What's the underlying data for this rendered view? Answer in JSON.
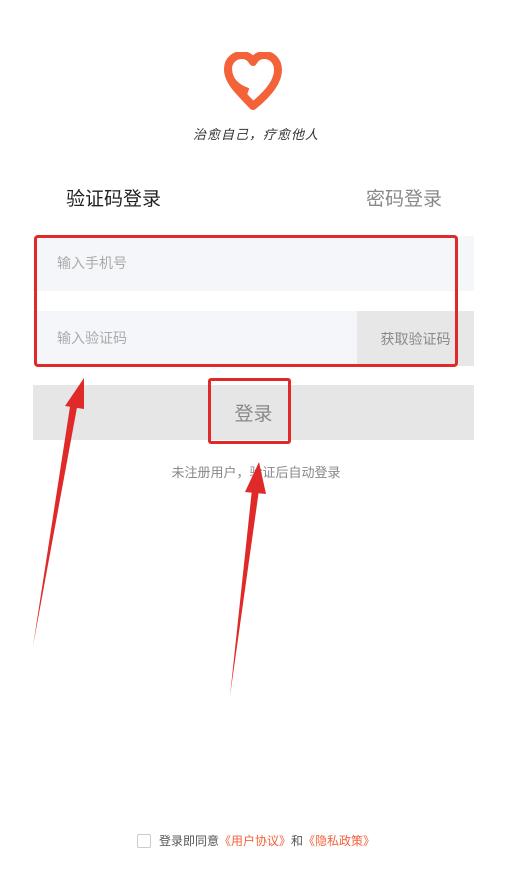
{
  "brand": {
    "logo_icon": "heart-logo-icon",
    "accent_color": "#f4623a",
    "slogan": "治愈自己，疗愈他人"
  },
  "tabs": {
    "sms_login": "验证码登录",
    "password_login": "密码登录"
  },
  "form": {
    "phone_placeholder": "输入手机号",
    "code_placeholder": "输入验证码",
    "get_code_label": "获取验证码",
    "login_label": "登录",
    "hint": "未注册用户，验证后自动登录"
  },
  "agreement": {
    "prefix": "登录即同意",
    "user_agreement": "《用户协议》",
    "and": "和",
    "privacy_policy": "《隐私政策》"
  },
  "annotations": {
    "color": "#e02a2a"
  }
}
